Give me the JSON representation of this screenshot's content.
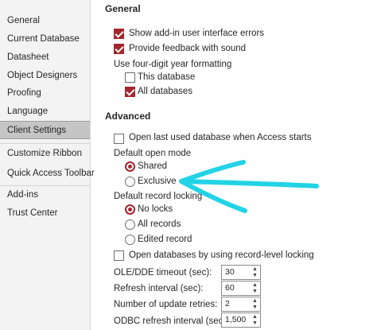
{
  "sidebar": {
    "items": [
      {
        "label": "General"
      },
      {
        "label": "Current Database"
      },
      {
        "label": "Datasheet"
      },
      {
        "label": "Object Designers"
      },
      {
        "label": "Proofing"
      },
      {
        "label": "Language"
      },
      {
        "label": "Client Settings",
        "active": true
      },
      {
        "label": "Customize Ribbon"
      },
      {
        "label": "Quick Access Toolbar"
      },
      {
        "label": "Add-ins"
      },
      {
        "label": "Trust Center"
      }
    ]
  },
  "general": {
    "heading": "General",
    "show_addin_errors": {
      "label": "Show add-in user interface errors",
      "checked": true
    },
    "feedback_sound": {
      "label": "Provide feedback with sound",
      "checked": true
    },
    "year_format_label": "Use four-digit year formatting",
    "this_database": {
      "label": "This database",
      "checked": false
    },
    "all_databases": {
      "label": "All databases",
      "checked": true
    }
  },
  "advanced": {
    "heading": "Advanced",
    "open_last_db": {
      "label": "Open last used database when Access starts",
      "checked": false
    },
    "open_mode_label": "Default open mode",
    "open_mode_shared": {
      "label": "Shared",
      "selected": true
    },
    "open_mode_exclusive": {
      "label": "Exclusive",
      "selected": false
    },
    "record_locking_label": "Default record locking",
    "lock_none": {
      "label": "No locks",
      "selected": true
    },
    "lock_all": {
      "label": "All records",
      "selected": false
    },
    "lock_edited": {
      "label": "Edited record",
      "selected": false
    },
    "record_level_locking": {
      "label": "Open databases by using record-level locking",
      "checked": false
    },
    "ole_timeout": {
      "label": "OLE/DDE timeout (sec):",
      "value": "30"
    },
    "refresh_interval": {
      "label": "Refresh interval (sec):",
      "value": "60"
    },
    "update_retries": {
      "label": "Number of update retries:",
      "value": "2"
    },
    "odbc_refresh": {
      "label": "ODBC refresh interval (sec):",
      "value": "1,500"
    }
  },
  "colors": {
    "accent": "#a4262c",
    "annotation": "#22d3e6"
  }
}
